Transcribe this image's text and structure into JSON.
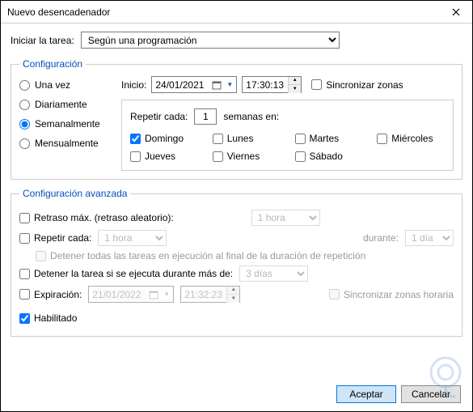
{
  "title": "Nuevo desencadenador",
  "begin": {
    "label": "Iniciar la tarea:",
    "selected": "Según una programación"
  },
  "config": {
    "legend": "Configuración",
    "freq": {
      "once": "Una vez",
      "daily": "Diariamente",
      "weekly": "Semanalmente",
      "monthly": "Mensualmente",
      "selected": "weekly"
    },
    "start": {
      "label": "Inicio:",
      "date": "24/01/2021",
      "time": "17:30:13"
    },
    "sync": {
      "label": "Sincronizar zonas",
      "checked": false
    },
    "recur": {
      "before": "Repetir cada:",
      "value": "1",
      "after": "semanas en:"
    },
    "days": {
      "sun": {
        "label": "Domingo",
        "checked": true
      },
      "mon": {
        "label": "Lunes",
        "checked": false
      },
      "tue": {
        "label": "Martes",
        "checked": false
      },
      "wed": {
        "label": "Miércoles",
        "checked": false
      },
      "thu": {
        "label": "Jueves",
        "checked": false
      },
      "fri": {
        "label": "Viernes",
        "checked": false
      },
      "sat": {
        "label": "Sábado",
        "checked": false
      }
    }
  },
  "adv": {
    "legend": "Configuración avanzada",
    "delay": {
      "label": "Retraso máx. (retraso aleatorio):",
      "value": "1 hora",
      "checked": false
    },
    "repeat": {
      "label": "Repetir cada:",
      "value": "1 hora",
      "durLabel": "durante:",
      "durValue": "1 día",
      "checked": false
    },
    "stopEnd": {
      "label": "Detener todas las tareas en ejecución al final de la duración de repetición",
      "checked": false
    },
    "stopIf": {
      "label": "Detener la tarea si se ejecuta durante más de:",
      "value": "3 días",
      "checked": false
    },
    "expire": {
      "label": "Expiración:",
      "date": "21/01/2022",
      "time": "21:32:23",
      "sync": "Sincronizar zonas horaria",
      "checked": false
    },
    "enabled": {
      "label": "Habilitado",
      "checked": true
    }
  },
  "buttons": {
    "ok": "Aceptar",
    "cancel": "Cancelar"
  }
}
